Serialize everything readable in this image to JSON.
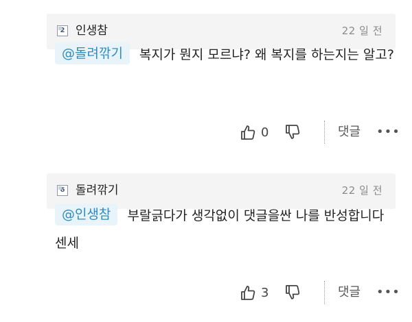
{
  "comments": [
    {
      "level": "2",
      "username": "인생참",
      "time": "22 일 전",
      "mention": "@돌려깎기",
      "text": "복지가 뭔지 모르냐? 왜 복지를 하는지는 알고?",
      "likes": "0",
      "reply_label": "댓글",
      "more_label": "•••"
    },
    {
      "level": "6",
      "username": "돌려깎기",
      "time": "22 일 전",
      "mention": "@인생참",
      "text": "부랄긁다가 생각없이 댓글을싼 나를 반성합니다 센세",
      "likes": "3",
      "reply_label": "댓글",
      "more_label": "•••"
    }
  ]
}
